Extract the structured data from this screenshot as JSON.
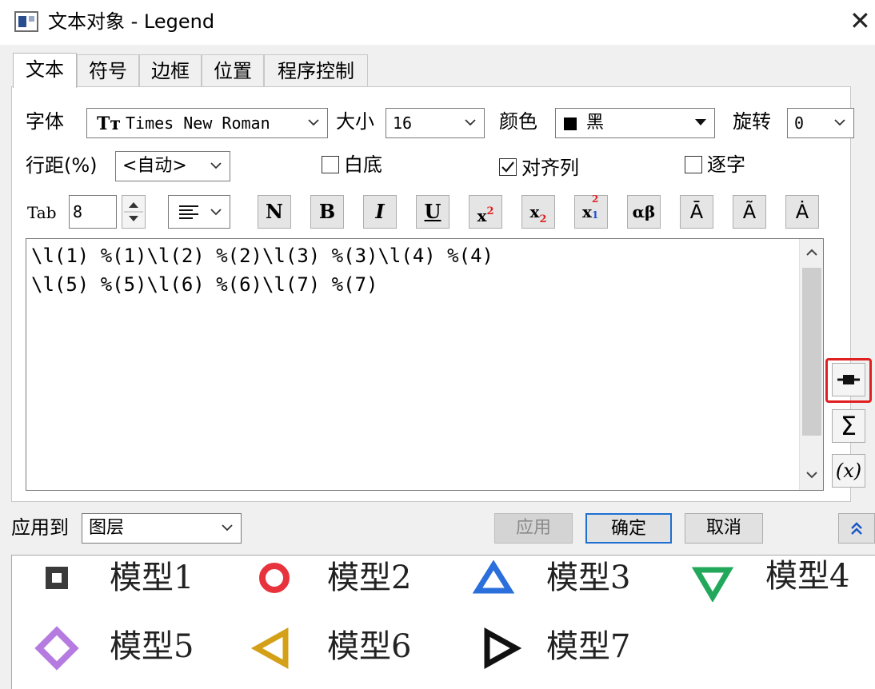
{
  "window": {
    "title": "文本对象 - Legend",
    "close_glyph": "✕"
  },
  "tabs": [
    "文本",
    "符号",
    "边框",
    "位置",
    "程序控制"
  ],
  "font_row": {
    "font_label": "字体",
    "font_value": "Times New Roman",
    "font_icon_glyph": "Tт",
    "size_label": "大小",
    "size_value": "16",
    "color_label": "颜色",
    "color_value": "黑",
    "color_swatch_hex": "#000000",
    "rotate_label": "旋转",
    "rotate_value": "0"
  },
  "spacing_row": {
    "spacing_label": "行距(%)",
    "spacing_value": "<自动>",
    "white_bg_label": "白底",
    "white_bg_checked": false,
    "align_col_label": "对齐列",
    "align_col_checked": true,
    "per_char_label": "逐字",
    "per_char_checked": false
  },
  "tab_row": {
    "tab_label": "Tab",
    "tab_value": "8"
  },
  "format_buttons": [
    {
      "name": "normal",
      "glyph": "N"
    },
    {
      "name": "bold",
      "glyph": "B"
    },
    {
      "name": "italic",
      "glyph": "I"
    },
    {
      "name": "underline",
      "glyph": "U"
    },
    {
      "name": "superscript",
      "glyph": "x",
      "script": "2"
    },
    {
      "name": "subscript",
      "glyph": "x",
      "script": "2"
    },
    {
      "name": "supersub",
      "glyph": "x",
      "sup": "2",
      "sub": "1"
    },
    {
      "name": "greek",
      "glyph": "αβ"
    },
    {
      "name": "overbar",
      "glyph": "Ā"
    },
    {
      "name": "tilde",
      "glyph": "Ã"
    },
    {
      "name": "dot",
      "glyph": "Ȧ"
    }
  ],
  "editor_lines": [
    "\\l(1) %(1)\\l(2) %(2)\\l(3) %(3)\\l(4) %(4)",
    "\\l(5) %(5)\\l(6) %(6)\\l(7) %(7)"
  ],
  "side_buttons": {
    "sigma_glyph": "Σ",
    "var_glyph": "(x)",
    "highlight_color": "#e02020"
  },
  "bottom_bar": {
    "apply_to_label": "应用到",
    "apply_to_value": "图层",
    "apply_button": "应用",
    "ok_button": "确定",
    "cancel_button": "取消"
  },
  "legend": {
    "entries": [
      {
        "label": "模型1",
        "symbol": "square",
        "color": "#3a3a3a"
      },
      {
        "label": "模型2",
        "symbol": "circle",
        "color": "#e8333c"
      },
      {
        "label": "模型3",
        "symbol": "triangle-up",
        "color": "#2a6fdb"
      },
      {
        "label": "模型4",
        "symbol": "triangle-down",
        "color": "#22a85a"
      },
      {
        "label": "模型5",
        "symbol": "diamond",
        "color": "#b57be0"
      },
      {
        "label": "模型6",
        "symbol": "triangle-left",
        "color": "#d4a017"
      },
      {
        "label": "模型7",
        "symbol": "triangle-right",
        "color": "#111111"
      }
    ]
  }
}
